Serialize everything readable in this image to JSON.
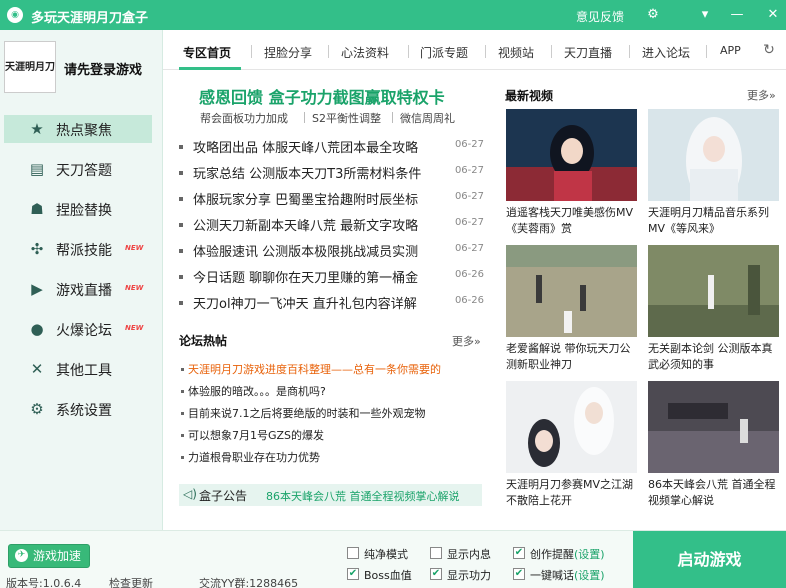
{
  "window": {
    "title": "多玩天涯明月刀盒子",
    "feedback": "意见反馈",
    "icons": [
      "gear-icon",
      "dropdown-icon",
      "minimize-icon",
      "close-icon"
    ]
  },
  "user": {
    "avatar_text": "天涯明月刀",
    "login_prompt": "请先登录游戏"
  },
  "sidebar": {
    "items": [
      {
        "label": "热点聚焦",
        "icon": "star-icon",
        "active": true,
        "badge": ""
      },
      {
        "label": "天刀答题",
        "icon": "quiz-icon",
        "active": false,
        "badge": ""
      },
      {
        "label": "捏脸替换",
        "icon": "mask-icon",
        "active": false,
        "badge": ""
      },
      {
        "label": "帮派技能",
        "icon": "pinwheel-icon",
        "active": false,
        "badge": "NEW"
      },
      {
        "label": "游戏直播",
        "icon": "play-icon",
        "active": false,
        "badge": "NEW"
      },
      {
        "label": "火爆论坛",
        "icon": "chat-icon",
        "active": false,
        "badge": "NEW"
      },
      {
        "label": "其他工具",
        "icon": "tools-icon",
        "active": false,
        "badge": ""
      },
      {
        "label": "系统设置",
        "icon": "settings-icon",
        "active": false,
        "badge": ""
      }
    ]
  },
  "tabs": [
    {
      "label": "专区首页",
      "active": true
    },
    {
      "label": "捏脸分享",
      "active": false
    },
    {
      "label": "心法资料",
      "active": false
    },
    {
      "label": "门派专题",
      "active": false
    },
    {
      "label": "视频站",
      "active": false
    },
    {
      "label": "天刀直播",
      "active": false
    },
    {
      "label": "进入论坛",
      "active": false
    },
    {
      "label": "APP",
      "active": false
    }
  ],
  "headline": {
    "title": "感恩回馈 盒子功力截图赢取特权卡",
    "links": [
      "帮会面板功力加成",
      "S2平衡性调整",
      "微信周周礼"
    ]
  },
  "news": [
    {
      "title": "攻略团出品 体服天峰八荒团本最全攻略",
      "date": "06-27"
    },
    {
      "title": "玩家总结 公测版本天刀T3所需材料条件",
      "date": "06-27"
    },
    {
      "title": "体服玩家分享 巴蜀墨宝拾趣附时辰坐标",
      "date": "06-27"
    },
    {
      "title": "公测天刀新副本天峰八荒 最新文字攻略",
      "date": "06-27"
    },
    {
      "title": "体验服速讯 公测版本极限挑战减员实测",
      "date": "06-27"
    },
    {
      "title": "今日话题 聊聊你在天刀里赚的第一桶金",
      "date": "06-26"
    },
    {
      "title": "天刀ol神刀一飞冲天 直升礼包内容详解",
      "date": "06-26"
    }
  ],
  "forum": {
    "header": "论坛热帖",
    "more": "更多»",
    "items": [
      {
        "title": "天涯明月刀游戏进度百科整理——总有一条你需要的",
        "hot": true
      },
      {
        "title": "体验服的暗改。。。是商机吗?",
        "hot": false
      },
      {
        "title": "目前来说7.1之后将要绝版的时装和一些外观宠物",
        "hot": false
      },
      {
        "title": "可以想象7月1号GZS的爆发",
        "hot": false
      },
      {
        "title": "力道根骨职业存在功力优势",
        "hot": false
      }
    ]
  },
  "announcement": {
    "label": "盒子公告",
    "text": "86本天峰会八荒 首通全程视频掌心解说"
  },
  "videos": {
    "header": "最新视频",
    "more": "更多»",
    "items": [
      {
        "title": "逍遥客栈天刀唯美感伤MV《芙蓉雨》赏"
      },
      {
        "title": "天涯明月刀精品音乐系列MV《等风来》"
      },
      {
        "title": "老爱酱解说 带你玩天刀公测新职业神刀"
      },
      {
        "title": "无关副本论剑 公测版本真武必须知的事"
      },
      {
        "title": "天涯明月刀参赛MV之江湖不散陪上花开"
      },
      {
        "title": "86本天峰会八荒 首通全程视频掌心解说"
      }
    ]
  },
  "bottom": {
    "speedup": "游戏加速",
    "version": "版本号:1.0.6.4",
    "check_update": "检查更新",
    "qq_group": "交流YY群:1288465",
    "options": [
      {
        "label": "纯净模式",
        "checked": false,
        "link": ""
      },
      {
        "label": "显示内息",
        "checked": false,
        "link": ""
      },
      {
        "label": "创作提醒",
        "checked": true,
        "link": "(设置)"
      },
      {
        "label": "Boss血值",
        "checked": true,
        "link": ""
      },
      {
        "label": "显示功力",
        "checked": true,
        "link": ""
      },
      {
        "label": "一键喊话",
        "checked": true,
        "link": "(设置)"
      }
    ],
    "launch": "启动游戏"
  }
}
